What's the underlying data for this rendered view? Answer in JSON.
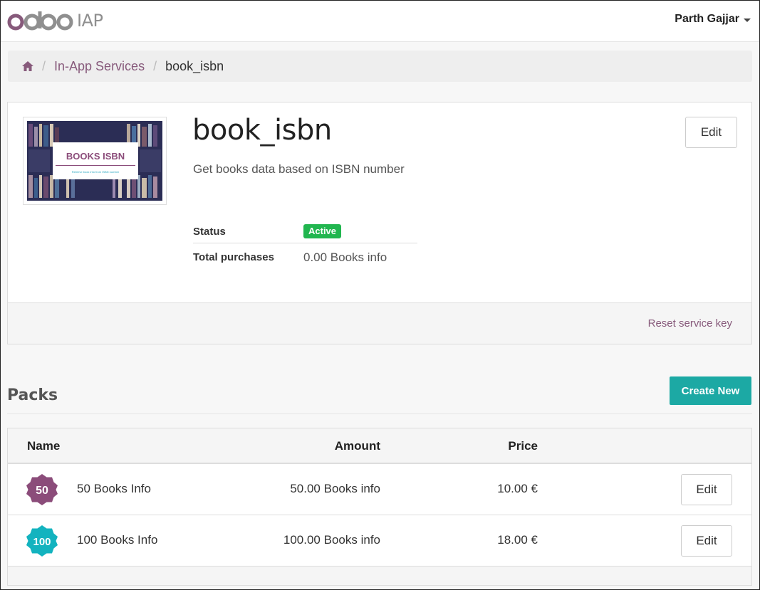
{
  "header": {
    "logo_text": "odoo",
    "logo_suffix": "IAP",
    "user_name": "Parth Gajjar"
  },
  "breadcrumb": {
    "items": [
      "In-App Services",
      "book_isbn"
    ]
  },
  "service": {
    "title": "book_isbn",
    "description": "Get books data based on ISBN number",
    "edit_label": "Edit",
    "thumbnail_title": "BOOKS ISBN",
    "thumbnail_subtitle": "Retrieve book info from ISBN number",
    "status_label": "Status",
    "status_value": "Active",
    "purchases_label": "Total purchases",
    "purchases_value": "0.00 Books info",
    "reset_label": "Reset service key"
  },
  "packs": {
    "title": "Packs",
    "create_label": "Create New",
    "columns": [
      "Name",
      "Amount",
      "Price"
    ],
    "rows": [
      {
        "badge": "50",
        "name": "50 Books Info",
        "amount": "50.00 Books info",
        "price": "10.00 €",
        "edit_label": "Edit",
        "color": "#8b4c7a"
      },
      {
        "badge": "100",
        "name": "100 Books Info",
        "amount": "100.00 Books info",
        "price": "18.00 €",
        "edit_label": "Edit",
        "color": "#13b3bf"
      }
    ]
  },
  "colors": {
    "brand": "#875a7b",
    "accent": "#1ca9a4",
    "success": "#21b64f"
  }
}
